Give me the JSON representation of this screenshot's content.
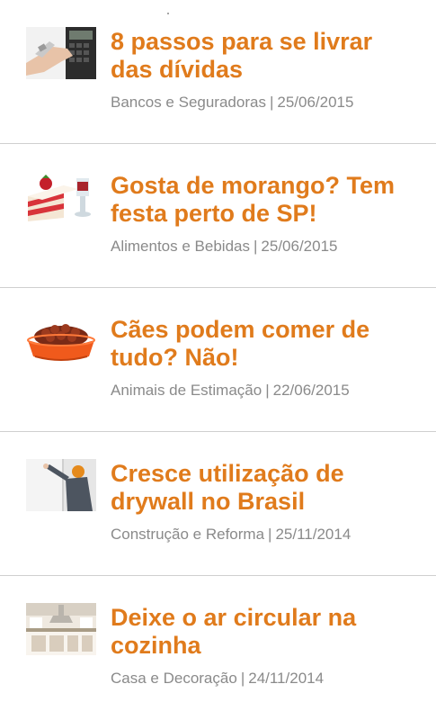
{
  "articles": [
    {
      "title": "8 passos para se livrar das dívidas",
      "category": "Bancos e Seguradoras",
      "separator": "|",
      "date": "25/06/2015",
      "icon": "calculator-hand-icon"
    },
    {
      "title": "Gosta de morango? Tem festa perto de SP!",
      "category": "Alimentos e Bebidas",
      "separator": "|",
      "date": "25/06/2015",
      "icon": "strawberry-cake-icon"
    },
    {
      "title": "Cães podem comer de tudo? Não!",
      "category": "Animais de Estimação",
      "separator": "|",
      "date": "22/06/2015",
      "icon": "dog-food-bowl-icon"
    },
    {
      "title": "Cresce utilização de drywall no Brasil",
      "category": "Construção e Reforma",
      "separator": "|",
      "date": "25/11/2014",
      "icon": "drywall-worker-icon"
    },
    {
      "title": "Deixe o ar circular na cozinha",
      "category": "Casa e Decoração",
      "separator": "|",
      "date": "24/11/2014",
      "icon": "kitchen-icon"
    }
  ],
  "colors": {
    "title": "#e07b1c",
    "meta": "#8a8a8a",
    "divider": "#cfcfcf"
  }
}
